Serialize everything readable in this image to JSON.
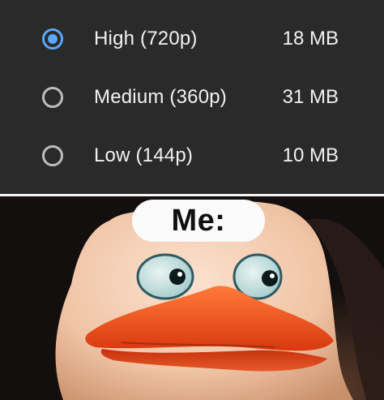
{
  "quality_options": [
    {
      "label": "High (720p)",
      "size": "18 MB",
      "selected": true
    },
    {
      "label": "Medium (360p)",
      "size": "31 MB",
      "selected": false
    },
    {
      "label": "Low (144p)",
      "size": "10 MB",
      "selected": false
    }
  ],
  "meme": {
    "caption": "Me:",
    "image_icon": "surprised-penguin-illustration"
  },
  "colors": {
    "dialog_bg": "#2a2a2a",
    "radio_selected": "#5aa7f7",
    "radio_unselected": "#bdbdbd",
    "text": "#f2f2f2",
    "beak": "#e84a1c"
  }
}
